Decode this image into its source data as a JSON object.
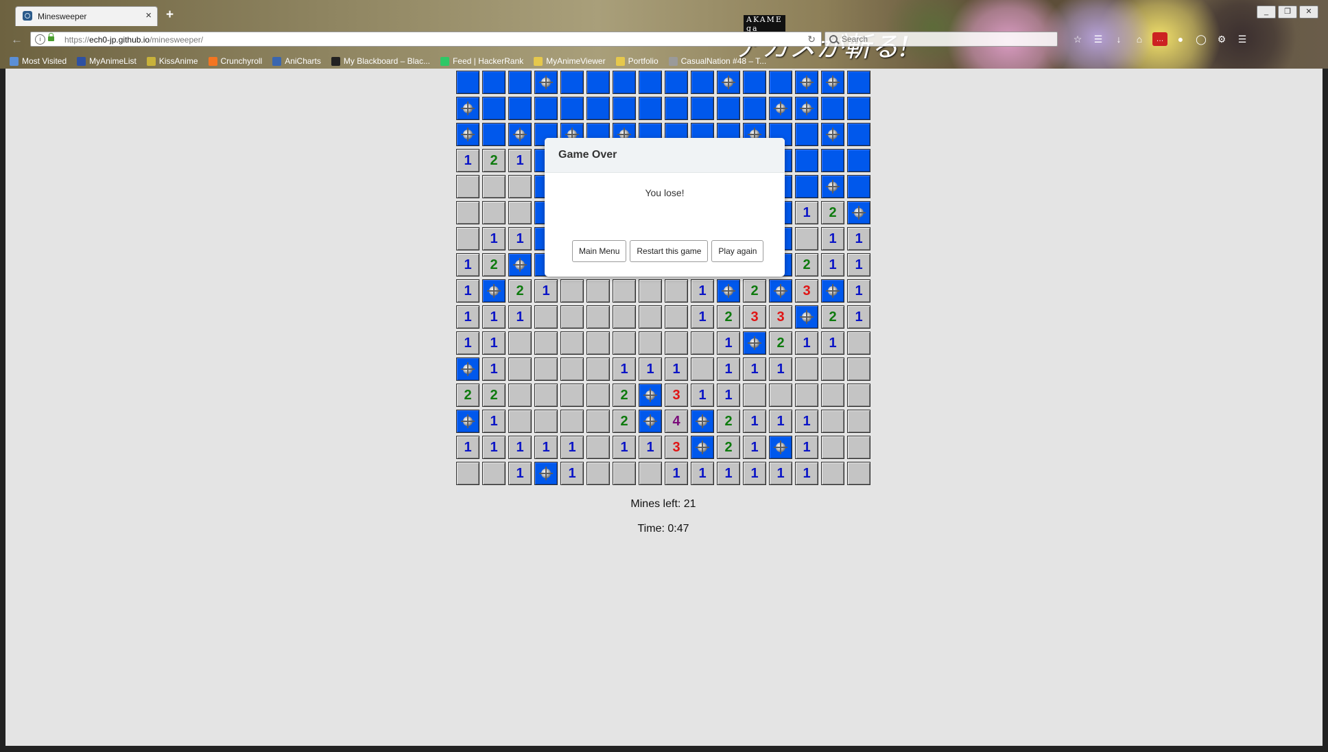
{
  "browser": {
    "tab_title": "Minesweeper",
    "tab_close": "×",
    "new_tab": "+",
    "url_prefix": "https://",
    "url_host": "ech0-jp.github.io",
    "url_path": "/minesweeper/",
    "search_placeholder": "Search",
    "theme_logo_small": "AKAME ga KILL!",
    "theme_logo_big": "アカメが斬る!",
    "window_controls": [
      "_",
      "❐",
      "✕"
    ],
    "toolbar_icons": [
      "star-icon",
      "reader-icon",
      "download-icon",
      "home-icon",
      "extension-icon",
      "lock-icon",
      "shield-icon",
      "puzzle-icon",
      "menu-icon"
    ],
    "bookmarks": [
      {
        "label": "Most Visited",
        "icon_color": "#5b8fd6"
      },
      {
        "label": "MyAnimeList",
        "icon_color": "#2e51a2"
      },
      {
        "label": "KissAnime",
        "icon_color": "#c8b23a"
      },
      {
        "label": "Crunchyroll",
        "icon_color": "#f47521"
      },
      {
        "label": "AniCharts",
        "icon_color": "#3a66b0"
      },
      {
        "label": "My Blackboard – Blac...",
        "icon_color": "#222222"
      },
      {
        "label": "Feed | HackerRank",
        "icon_color": "#2ec866"
      },
      {
        "label": "MyAnimeViewer",
        "icon_color": "#e6c84c"
      },
      {
        "label": "Portfolio",
        "icon_color": "#e6c84c"
      },
      {
        "label": "CasualNation #48 – T...",
        "icon_color": "#9a9a9a"
      }
    ]
  },
  "game": {
    "board": [
      [
        "H",
        "H",
        "H",
        "M",
        "H",
        "H",
        "H",
        "H",
        "H",
        "H",
        "M",
        "H",
        "H",
        "M",
        "M",
        "H"
      ],
      [
        "M",
        "H",
        "H",
        "H",
        "H",
        "H",
        "H",
        "H",
        "H",
        "H",
        "H",
        "H",
        "M",
        "M",
        "H",
        "H"
      ],
      [
        "M",
        "H",
        "M",
        "H",
        "M",
        "H",
        "M",
        "H",
        "H",
        "H",
        "H",
        "M",
        "H",
        "H",
        "M",
        "H"
      ],
      [
        "1",
        "2",
        "1",
        "H",
        "H",
        "H",
        "H",
        "H",
        "H",
        "H",
        "H",
        "H",
        "H",
        "H",
        "H",
        "H"
      ],
      [
        "0",
        "0",
        "0",
        "H",
        "H",
        "H",
        "H",
        "H",
        "H",
        "H",
        "H",
        "H",
        "H",
        "H",
        "M",
        "H"
      ],
      [
        "0",
        "0",
        "0",
        "H",
        "H",
        "H",
        "H",
        "H",
        "H",
        "H",
        "H",
        "H",
        "H",
        "1",
        "2",
        "M"
      ],
      [
        "0",
        "1",
        "1",
        "H",
        "H",
        "H",
        "H",
        "H",
        "H",
        "H",
        "H",
        "H",
        "H",
        "0",
        "1",
        "1"
      ],
      [
        "1",
        "2",
        "M",
        "H",
        "H",
        "H",
        "H",
        "H",
        "H",
        "H",
        "H",
        "H",
        "H",
        "2",
        "1",
        "1"
      ],
      [
        "1",
        "M",
        "2",
        "1",
        "0",
        "0",
        "0",
        "0",
        "0",
        "1",
        "M",
        "2",
        "M",
        "3",
        "M",
        "1"
      ],
      [
        "1",
        "1",
        "1",
        "0",
        "0",
        "0",
        "0",
        "0",
        "0",
        "1",
        "2",
        "3",
        "3",
        "M",
        "2",
        "1"
      ],
      [
        "1",
        "1",
        "0",
        "0",
        "0",
        "0",
        "0",
        "0",
        "0",
        "0",
        "1",
        "M",
        "2",
        "1",
        "1",
        "0"
      ],
      [
        "M",
        "1",
        "0",
        "0",
        "0",
        "0",
        "1",
        "1",
        "1",
        "0",
        "1",
        "1",
        "1",
        "0",
        "0",
        "0"
      ],
      [
        "2",
        "2",
        "0",
        "0",
        "0",
        "0",
        "2",
        "M",
        "3",
        "1",
        "1",
        "0",
        "0",
        "0",
        "0",
        "0"
      ],
      [
        "M",
        "1",
        "0",
        "0",
        "0",
        "0",
        "2",
        "M",
        "4",
        "M",
        "2",
        "1",
        "1",
        "1",
        "0",
        "0"
      ],
      [
        "1",
        "1",
        "1",
        "1",
        "1",
        "0",
        "1",
        "1",
        "3",
        "M",
        "2",
        "1",
        "M",
        "1",
        "0",
        "0"
      ],
      [
        "0",
        "0",
        "1",
        "M",
        "1",
        "0",
        "0",
        "0",
        "1",
        "1",
        "1",
        "1",
        "1",
        "1",
        "0",
        "0"
      ]
    ],
    "mines_left_text": "Mines left: 21",
    "time_text": "Time: 0:47"
  },
  "modal": {
    "title": "Game Over",
    "message": "You lose!",
    "buttons": {
      "main_menu": "Main Menu",
      "restart": "Restart this game",
      "play_again": "Play again"
    }
  }
}
